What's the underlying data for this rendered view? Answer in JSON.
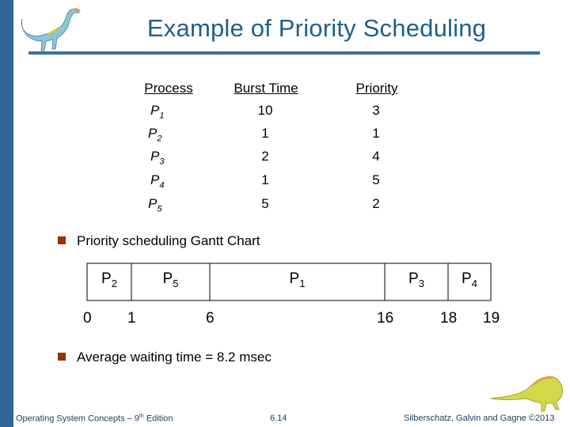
{
  "slide": {
    "title": "Example of Priority Scheduling",
    "accent_color": "#336699",
    "title_color": "#1f5f8b",
    "bullet_color": "#993300"
  },
  "table": {
    "headers": [
      "Process",
      "Burst Time",
      "Priority"
    ],
    "rows": [
      {
        "process": "P",
        "sub": "1",
        "burst": "10",
        "priority": "3"
      },
      {
        "process": "P",
        "sub": "2",
        "burst": "1",
        "priority": "1"
      },
      {
        "process": "P",
        "sub": "3",
        "burst": "2",
        "priority": "4"
      },
      {
        "process": "P",
        "sub": "4",
        "burst": "1",
        "priority": "5"
      },
      {
        "process": "P",
        "sub": "5",
        "burst": "5",
        "priority": "2"
      }
    ]
  },
  "bullets": {
    "gantt_heading": "Priority scheduling Gantt Chart",
    "avg_wait": "Average waiting time = 8.2 msec"
  },
  "chart_data": {
    "type": "gantt",
    "title": "Priority scheduling Gantt Chart",
    "segments": [
      {
        "label": "P",
        "sub": "2",
        "start": 0,
        "end": 1
      },
      {
        "label": "P",
        "sub": "5",
        "start": 1,
        "end": 6
      },
      {
        "label": "P",
        "sub": "1",
        "start": 6,
        "end": 16
      },
      {
        "label": "P",
        "sub": "3",
        "start": 16,
        "end": 18
      },
      {
        "label": "P",
        "sub": "4",
        "start": 18,
        "end": 19
      }
    ],
    "ticks": [
      "0",
      "1",
      "6",
      "16",
      "18",
      "19"
    ]
  },
  "footer": {
    "book": "Operating System Concepts – 9",
    "book_sup": "th",
    "book_suffix": " Edition",
    "page": "6.14",
    "copyright": "Silberschatz, Galvin and Gagne ©2013"
  },
  "icons": {
    "top": "dinosaur-illustration",
    "bottom": "dinosaur-illustration"
  }
}
